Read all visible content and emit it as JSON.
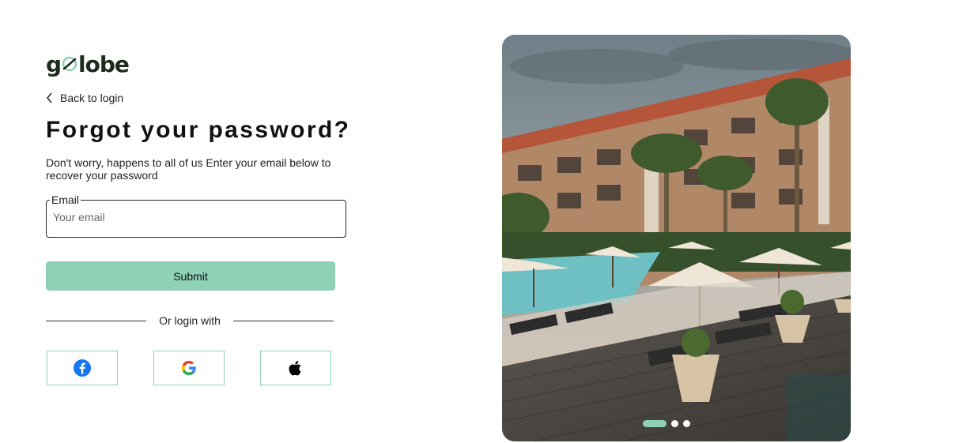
{
  "brand": {
    "logo_left": "g",
    "logo_right": "lobe",
    "accent_color": "#8ed1b7"
  },
  "back_link": {
    "label": "Back to login",
    "icon": "chevron-left-icon"
  },
  "page": {
    "title": "Forgot your password?",
    "subtitle": "Don't worry, happens to all of us Enter your email below to recover your password"
  },
  "email_field": {
    "label": "Email",
    "placeholder": "Your email",
    "value": ""
  },
  "submit_button": {
    "label": "Submit"
  },
  "divider": {
    "label": "Or login with"
  },
  "social_buttons": [
    {
      "provider": "facebook",
      "icon": "facebook-icon"
    },
    {
      "provider": "google",
      "icon": "google-icon"
    },
    {
      "provider": "apple",
      "icon": "apple-icon"
    }
  ],
  "carousel": {
    "image": "resort-pool-photo",
    "slide_count": 3,
    "active_slide": 1
  }
}
